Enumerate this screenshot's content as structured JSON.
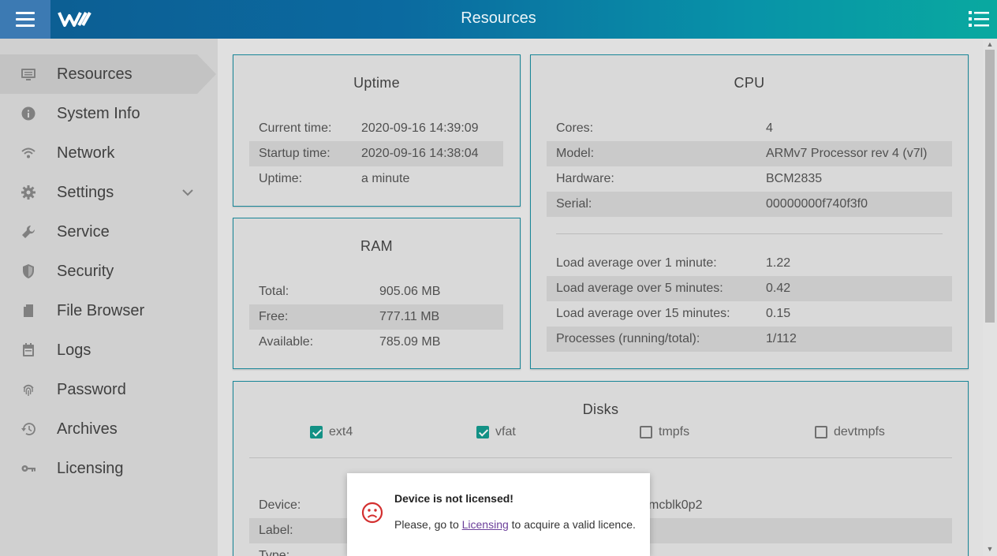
{
  "header": {
    "title": "Resources"
  },
  "sidebar": {
    "items": [
      {
        "label": "Resources",
        "icon": "monitor-icon"
      },
      {
        "label": "System Info",
        "icon": "info-icon"
      },
      {
        "label": "Network",
        "icon": "wifi-icon"
      },
      {
        "label": "Settings",
        "icon": "gear-icon"
      },
      {
        "label": "Service",
        "icon": "wrench-icon"
      },
      {
        "label": "Security",
        "icon": "shield-icon"
      },
      {
        "label": "File Browser",
        "icon": "file-icon"
      },
      {
        "label": "Logs",
        "icon": "calendar-icon"
      },
      {
        "label": "Password",
        "icon": "fingerprint-icon"
      },
      {
        "label": "Archives",
        "icon": "history-icon"
      },
      {
        "label": "Licensing",
        "icon": "key-icon"
      }
    ]
  },
  "uptime": {
    "title": "Uptime",
    "rows": [
      {
        "key": "Current time:",
        "value": "2020-09-16 14:39:09"
      },
      {
        "key": "Startup time:",
        "value": "2020-09-16 14:38:04"
      },
      {
        "key": "Uptime:",
        "value": "a minute"
      }
    ]
  },
  "ram": {
    "title": "RAM",
    "rows": [
      {
        "key": "Total:",
        "value": "905.06 MB"
      },
      {
        "key": "Free:",
        "value": "777.11 MB"
      },
      {
        "key": "Available:",
        "value": "785.09 MB"
      }
    ]
  },
  "cpu": {
    "title": "CPU",
    "rows": [
      {
        "key": "Cores:",
        "value": "4"
      },
      {
        "key": "Model:",
        "value": "ARMv7 Processor rev 4 (v7l)"
      },
      {
        "key": "Hardware:",
        "value": "BCM2835"
      },
      {
        "key": "Serial:",
        "value": "00000000f740f3f0"
      }
    ],
    "load_rows": [
      {
        "key": "Load average over 1 minute:",
        "value": "1.22"
      },
      {
        "key": "Load average over 5 minutes:",
        "value": "0.42"
      },
      {
        "key": "Load average over 15 minutes:",
        "value": "0.15"
      },
      {
        "key": "Processes (running/total):",
        "value": "1/112"
      }
    ]
  },
  "disks": {
    "title": "Disks",
    "filters": [
      {
        "label": "ext4",
        "checked": true
      },
      {
        "label": "vfat",
        "checked": true
      },
      {
        "label": "tmpfs",
        "checked": false
      },
      {
        "label": "devtmpfs",
        "checked": false
      }
    ],
    "rows": [
      {
        "key": "Device:",
        "value": "mcblk0p2"
      },
      {
        "key": "Label:",
        "value": ""
      },
      {
        "key": "Type:",
        "value": ""
      }
    ]
  },
  "dialog": {
    "title": "Device is not licensed!",
    "msg_prefix": "Please, go to ",
    "link": "Licensing",
    "msg_suffix": " to acquire a valid licence."
  },
  "colors": {
    "accent": "#1a8fa2",
    "checkbox": "#159b8e",
    "error": "#d32f2f"
  }
}
